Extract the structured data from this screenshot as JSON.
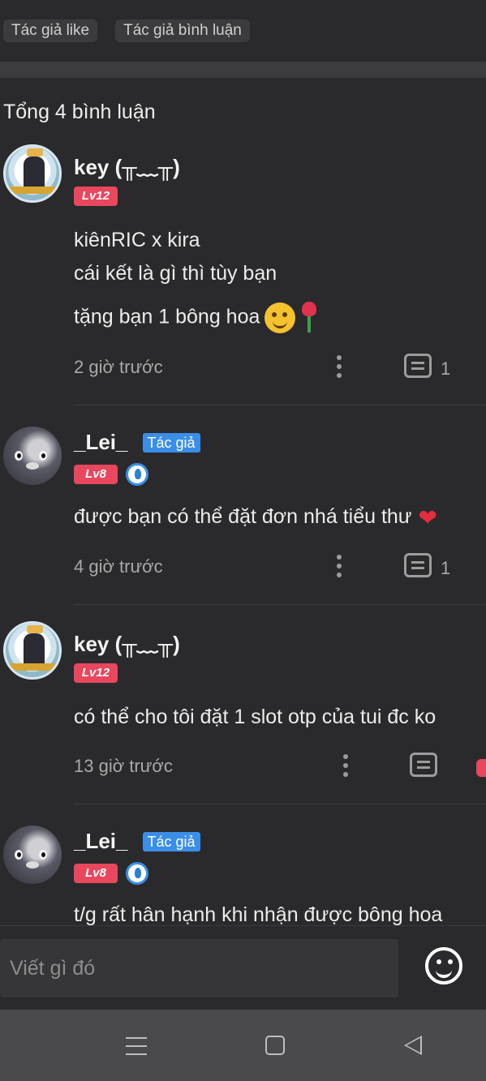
{
  "filters": {
    "author_like": "Tác giả like",
    "author_comment": "Tác giả bình luận"
  },
  "total_comments": "Tổng 4 bình luận",
  "author_tag": "Tác giả",
  "comments": [
    {
      "user": "key (╥﹏╥)",
      "level": "Lv12",
      "lines": [
        "kiênRIC x kira",
        "cái kết là gì thì tùy bạn",
        "tặng bạn 1 bông hoa"
      ],
      "time": "2 giờ trước",
      "reply_count": "1"
    },
    {
      "user": "_Lei_",
      "level": "Lv8",
      "lines": [
        "được bạn có thể đặt đơn nhá tiểu thư"
      ],
      "time": "4 giờ trước",
      "reply_count": "1"
    },
    {
      "user": "key (╥﹏╥)",
      "level": "Lv12",
      "lines": [
        "có thể cho tôi đặt 1 slot otp của tui đc ko"
      ],
      "time": "13 giờ trước",
      "reply_count": ""
    },
    {
      "user": "_Lei_",
      "level": "Lv8",
      "lines": [
        "t/g rất hân hạnh khi nhận được bông hoa"
      ],
      "time": "",
      "reply_count": ""
    }
  ],
  "input": {
    "placeholder": "Viết gì đó"
  },
  "icons": {
    "more": "more-vertical-icon",
    "reply": "comment-icon",
    "emoji": "emoji-icon",
    "nav_menu": "menu-icon",
    "nav_home": "home-icon",
    "nav_back": "back-icon",
    "author_badge": "verified-badge-icon"
  },
  "colors": {
    "level_badge": "#e8475e",
    "author_tag": "#3a8ee8",
    "background": "#2a2a2c"
  }
}
